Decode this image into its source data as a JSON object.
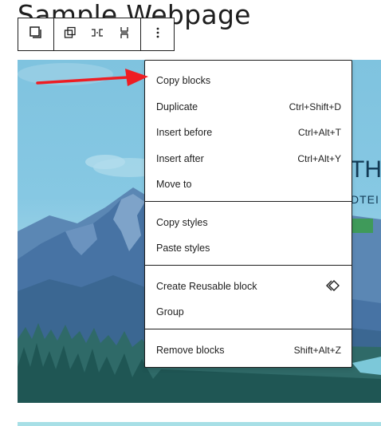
{
  "page": {
    "title": "Sample Webpage"
  },
  "hero": {
    "heading_fragment": "TH",
    "sub_fragment": "DTEI"
  },
  "toolbar": {
    "buttons": [
      {
        "icon": "block-icon"
      },
      {
        "icon": "group-icon"
      },
      {
        "icon": "columns-icon"
      },
      {
        "icon": "height-icon"
      },
      {
        "icon": "more-options-icon"
      }
    ]
  },
  "menu": {
    "sections": [
      {
        "items": [
          {
            "label": "Copy blocks",
            "shortcut": ""
          },
          {
            "label": "Duplicate",
            "shortcut": "Ctrl+Shift+D"
          },
          {
            "label": "Insert before",
            "shortcut": "Ctrl+Alt+T"
          },
          {
            "label": "Insert after",
            "shortcut": "Ctrl+Alt+Y"
          },
          {
            "label": "Move to",
            "shortcut": ""
          }
        ]
      },
      {
        "items": [
          {
            "label": "Copy styles",
            "shortcut": ""
          },
          {
            "label": "Paste styles",
            "shortcut": ""
          }
        ]
      },
      {
        "items": [
          {
            "label": "Create Reusable block",
            "icon": "reusable-block-icon"
          },
          {
            "label": "Group",
            "shortcut": ""
          }
        ]
      },
      {
        "items": [
          {
            "label": "Remove blocks",
            "shortcut": "Shift+Alt+Z"
          }
        ]
      }
    ]
  },
  "colors": {
    "accent_arrow": "#ee1d23",
    "hero_sky": "#86c8e3",
    "hero_button": "#3f9a5a"
  }
}
